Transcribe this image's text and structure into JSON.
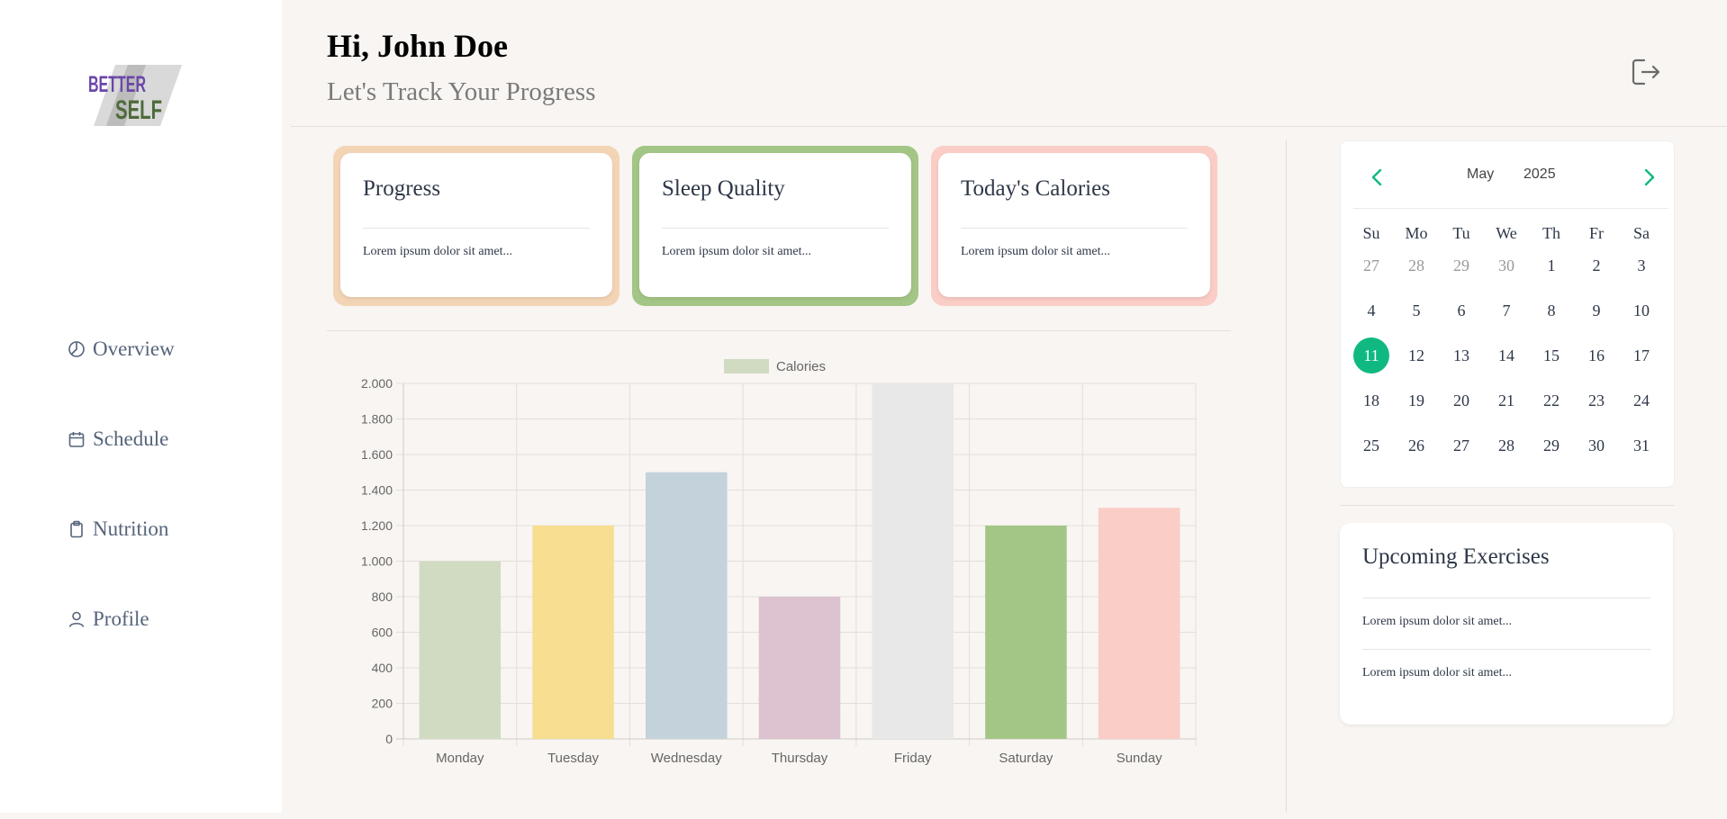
{
  "sidebar": {
    "logo": {
      "line1": "BETTER",
      "line2": "SELF"
    },
    "items": [
      {
        "label": "Overview",
        "icon": "pie-chart-icon"
      },
      {
        "label": "Schedule",
        "icon": "calendar-icon"
      },
      {
        "label": "Nutrition",
        "icon": "clipboard-icon"
      },
      {
        "label": "Profile",
        "icon": "user-icon"
      }
    ]
  },
  "header": {
    "title": "Hi, John Doe",
    "subtitle": "Let's Track Your Progress",
    "logout_icon": "logout-icon"
  },
  "cards": [
    {
      "title": "Progress",
      "text": "Lorem ipsum dolor sit amet...",
      "border_color": "#f3d4b5"
    },
    {
      "title": "Sleep Quality",
      "text": "Lorem ipsum dolor sit amet...",
      "border_color": "#a3c585"
    },
    {
      "title": "Today's Calories",
      "text": "Lorem ipsum dolor sit amet...",
      "border_color": "#facdc6"
    }
  ],
  "chart_data": {
    "type": "bar",
    "categories": [
      "Monday",
      "Tuesday",
      "Wednesday",
      "Thursday",
      "Friday",
      "Saturday",
      "Sunday"
    ],
    "series": [
      {
        "name": "Calories",
        "values": [
          1000,
          1200,
          1500,
          800,
          2000,
          1200,
          1300
        ]
      }
    ],
    "colors": [
      "#d1dbc2",
      "#f7de90",
      "#c3d2db",
      "#dcc3cf",
      "#e8e8e9",
      "#a3c585",
      "#facdc6"
    ],
    "legend_color": "#d1dbc2",
    "y_ticks": [
      "0",
      "200",
      "400",
      "600",
      "800",
      "1.000",
      "1.200",
      "1.400",
      "1.600",
      "1.800",
      "2.000"
    ],
    "ylim": [
      0,
      2000
    ],
    "grid": true,
    "legend": "top"
  },
  "calendar": {
    "month": "May",
    "year": "2025",
    "weekdays": [
      "Su",
      "Mo",
      "Tu",
      "We",
      "Th",
      "Fr",
      "Sa"
    ],
    "days": [
      [
        "27",
        "28",
        "29",
        "30",
        "1",
        "2",
        "3"
      ],
      [
        "4",
        "5",
        "6",
        "7",
        "8",
        "9",
        "10"
      ],
      [
        "11",
        "12",
        "13",
        "14",
        "15",
        "16",
        "17"
      ],
      [
        "18",
        "19",
        "20",
        "21",
        "22",
        "23",
        "24"
      ],
      [
        "25",
        "26",
        "27",
        "28",
        "29",
        "30",
        "31"
      ]
    ],
    "muted_days": [
      "27",
      "28",
      "29",
      "30"
    ],
    "selected_day": "11",
    "accent": "#10b981"
  },
  "upcoming": {
    "title": "Upcoming Exercises",
    "items": [
      "Lorem ipsum dolor sit amet...",
      "Lorem ipsum dolor sit amet..."
    ]
  }
}
